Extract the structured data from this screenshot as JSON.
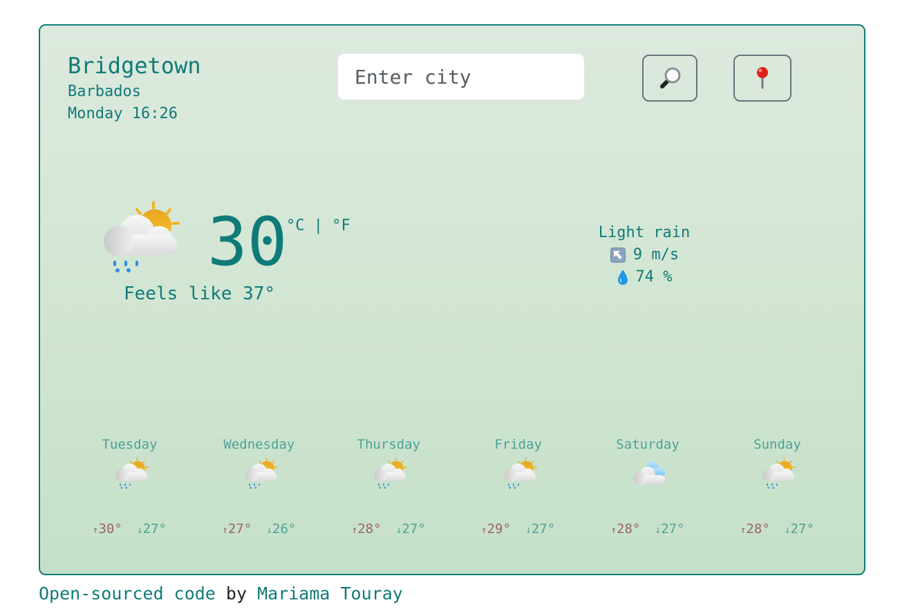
{
  "location": {
    "city": "Bridgetown",
    "country": "Barbados",
    "datetime": "Monday 16:26"
  },
  "search": {
    "placeholder": "Enter city",
    "value": "",
    "search_button_icon": "magnifying-glass-icon",
    "location_button_icon": "round-pushpin-icon"
  },
  "current": {
    "icon": "partly-cloudy-rain",
    "temperature": "30",
    "unit_celsius": "°C",
    "unit_separator": "|",
    "unit_fahrenheit": "°F",
    "feels_like": "Feels like 37°",
    "description": "Light rain",
    "wind_icon": "up-left-arrow-icon",
    "wind": "9 m/s",
    "humidity_icon": "droplet-icon",
    "humidity": "74 %"
  },
  "forecast": [
    {
      "day": "Tuesday",
      "icon": "partly-cloudy-rain",
      "high": "30°",
      "low": "27°"
    },
    {
      "day": "Wednesday",
      "icon": "partly-cloudy-rain",
      "high": "27°",
      "low": "26°"
    },
    {
      "day": "Thursday",
      "icon": "partly-cloudy-rain",
      "high": "28°",
      "low": "27°"
    },
    {
      "day": "Friday",
      "icon": "partly-cloudy-rain",
      "high": "29°",
      "low": "27°"
    },
    {
      "day": "Saturday",
      "icon": "cloudy",
      "high": "28°",
      "low": "27°"
    },
    {
      "day": "Sunday",
      "icon": "partly-cloudy-rain",
      "high": "28°",
      "low": "27°"
    }
  ],
  "arrows": {
    "up": "↑",
    "down": "↓"
  },
  "footer": {
    "link_code": "Open-sourced code",
    "by": " by ",
    "link_author": "Mariama Touray"
  },
  "colors": {
    "accent": "#0f7b78",
    "forecast_day": "#4ea197",
    "high_temp": "#9a6660",
    "low_temp": "#4ea197"
  }
}
